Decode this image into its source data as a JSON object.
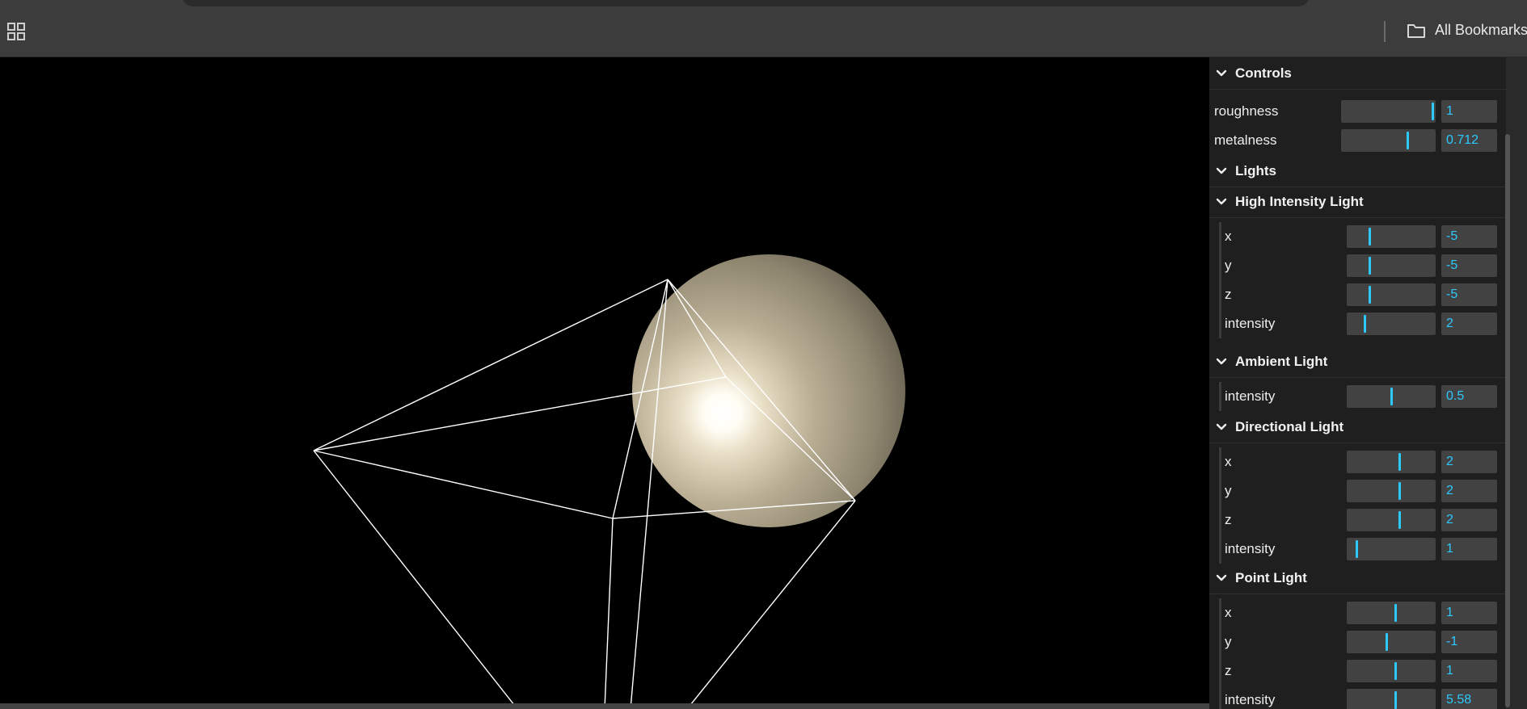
{
  "bookmarks_bar": {
    "apps_icon": "grid-apps-icon",
    "folder_icon": "folder-icon",
    "all_bookmarks_label": "All Bookmarks"
  },
  "gui": {
    "controls_title": "Controls",
    "material": [
      {
        "label": "roughness",
        "value": "1",
        "level": 0.98
      },
      {
        "label": "metalness",
        "value": "0.712",
        "level": 0.71
      }
    ],
    "lights_title": "Lights",
    "high_intensity": {
      "title": "High Intensity Light",
      "rows": [
        {
          "label": "x",
          "value": "-5",
          "level": 0.25
        },
        {
          "label": "y",
          "value": "-5",
          "level": 0.25
        },
        {
          "label": "z",
          "value": "-5",
          "level": 0.25
        },
        {
          "label": "intensity",
          "value": "2",
          "level": 0.2
        }
      ]
    },
    "ambient": {
      "title": "Ambient Light",
      "rows": [
        {
          "label": "intensity",
          "value": "0.5",
          "level": 0.5
        }
      ]
    },
    "directional": {
      "title": "Directional Light",
      "rows": [
        {
          "label": "x",
          "value": "2",
          "level": 0.6
        },
        {
          "label": "y",
          "value": "2",
          "level": 0.6
        },
        {
          "label": "z",
          "value": "2",
          "level": 0.6
        },
        {
          "label": "intensity",
          "value": "1",
          "level": 0.1
        }
      ]
    },
    "point": {
      "title": "Point Light",
      "rows": [
        {
          "label": "x",
          "value": "1",
          "level": 0.55
        },
        {
          "label": "y",
          "value": "-1",
          "level": 0.45
        },
        {
          "label": "z",
          "value": "1",
          "level": 0.55
        },
        {
          "label": "intensity",
          "value": "5.58",
          "level": 0.55
        }
      ]
    }
  },
  "colors": {
    "accent": "#2cc9ff",
    "panel_bg": "#1f1f1f",
    "field_bg": "#424242",
    "toolbar_bg": "#3c3c3c",
    "sphere": "#b8ad95"
  }
}
